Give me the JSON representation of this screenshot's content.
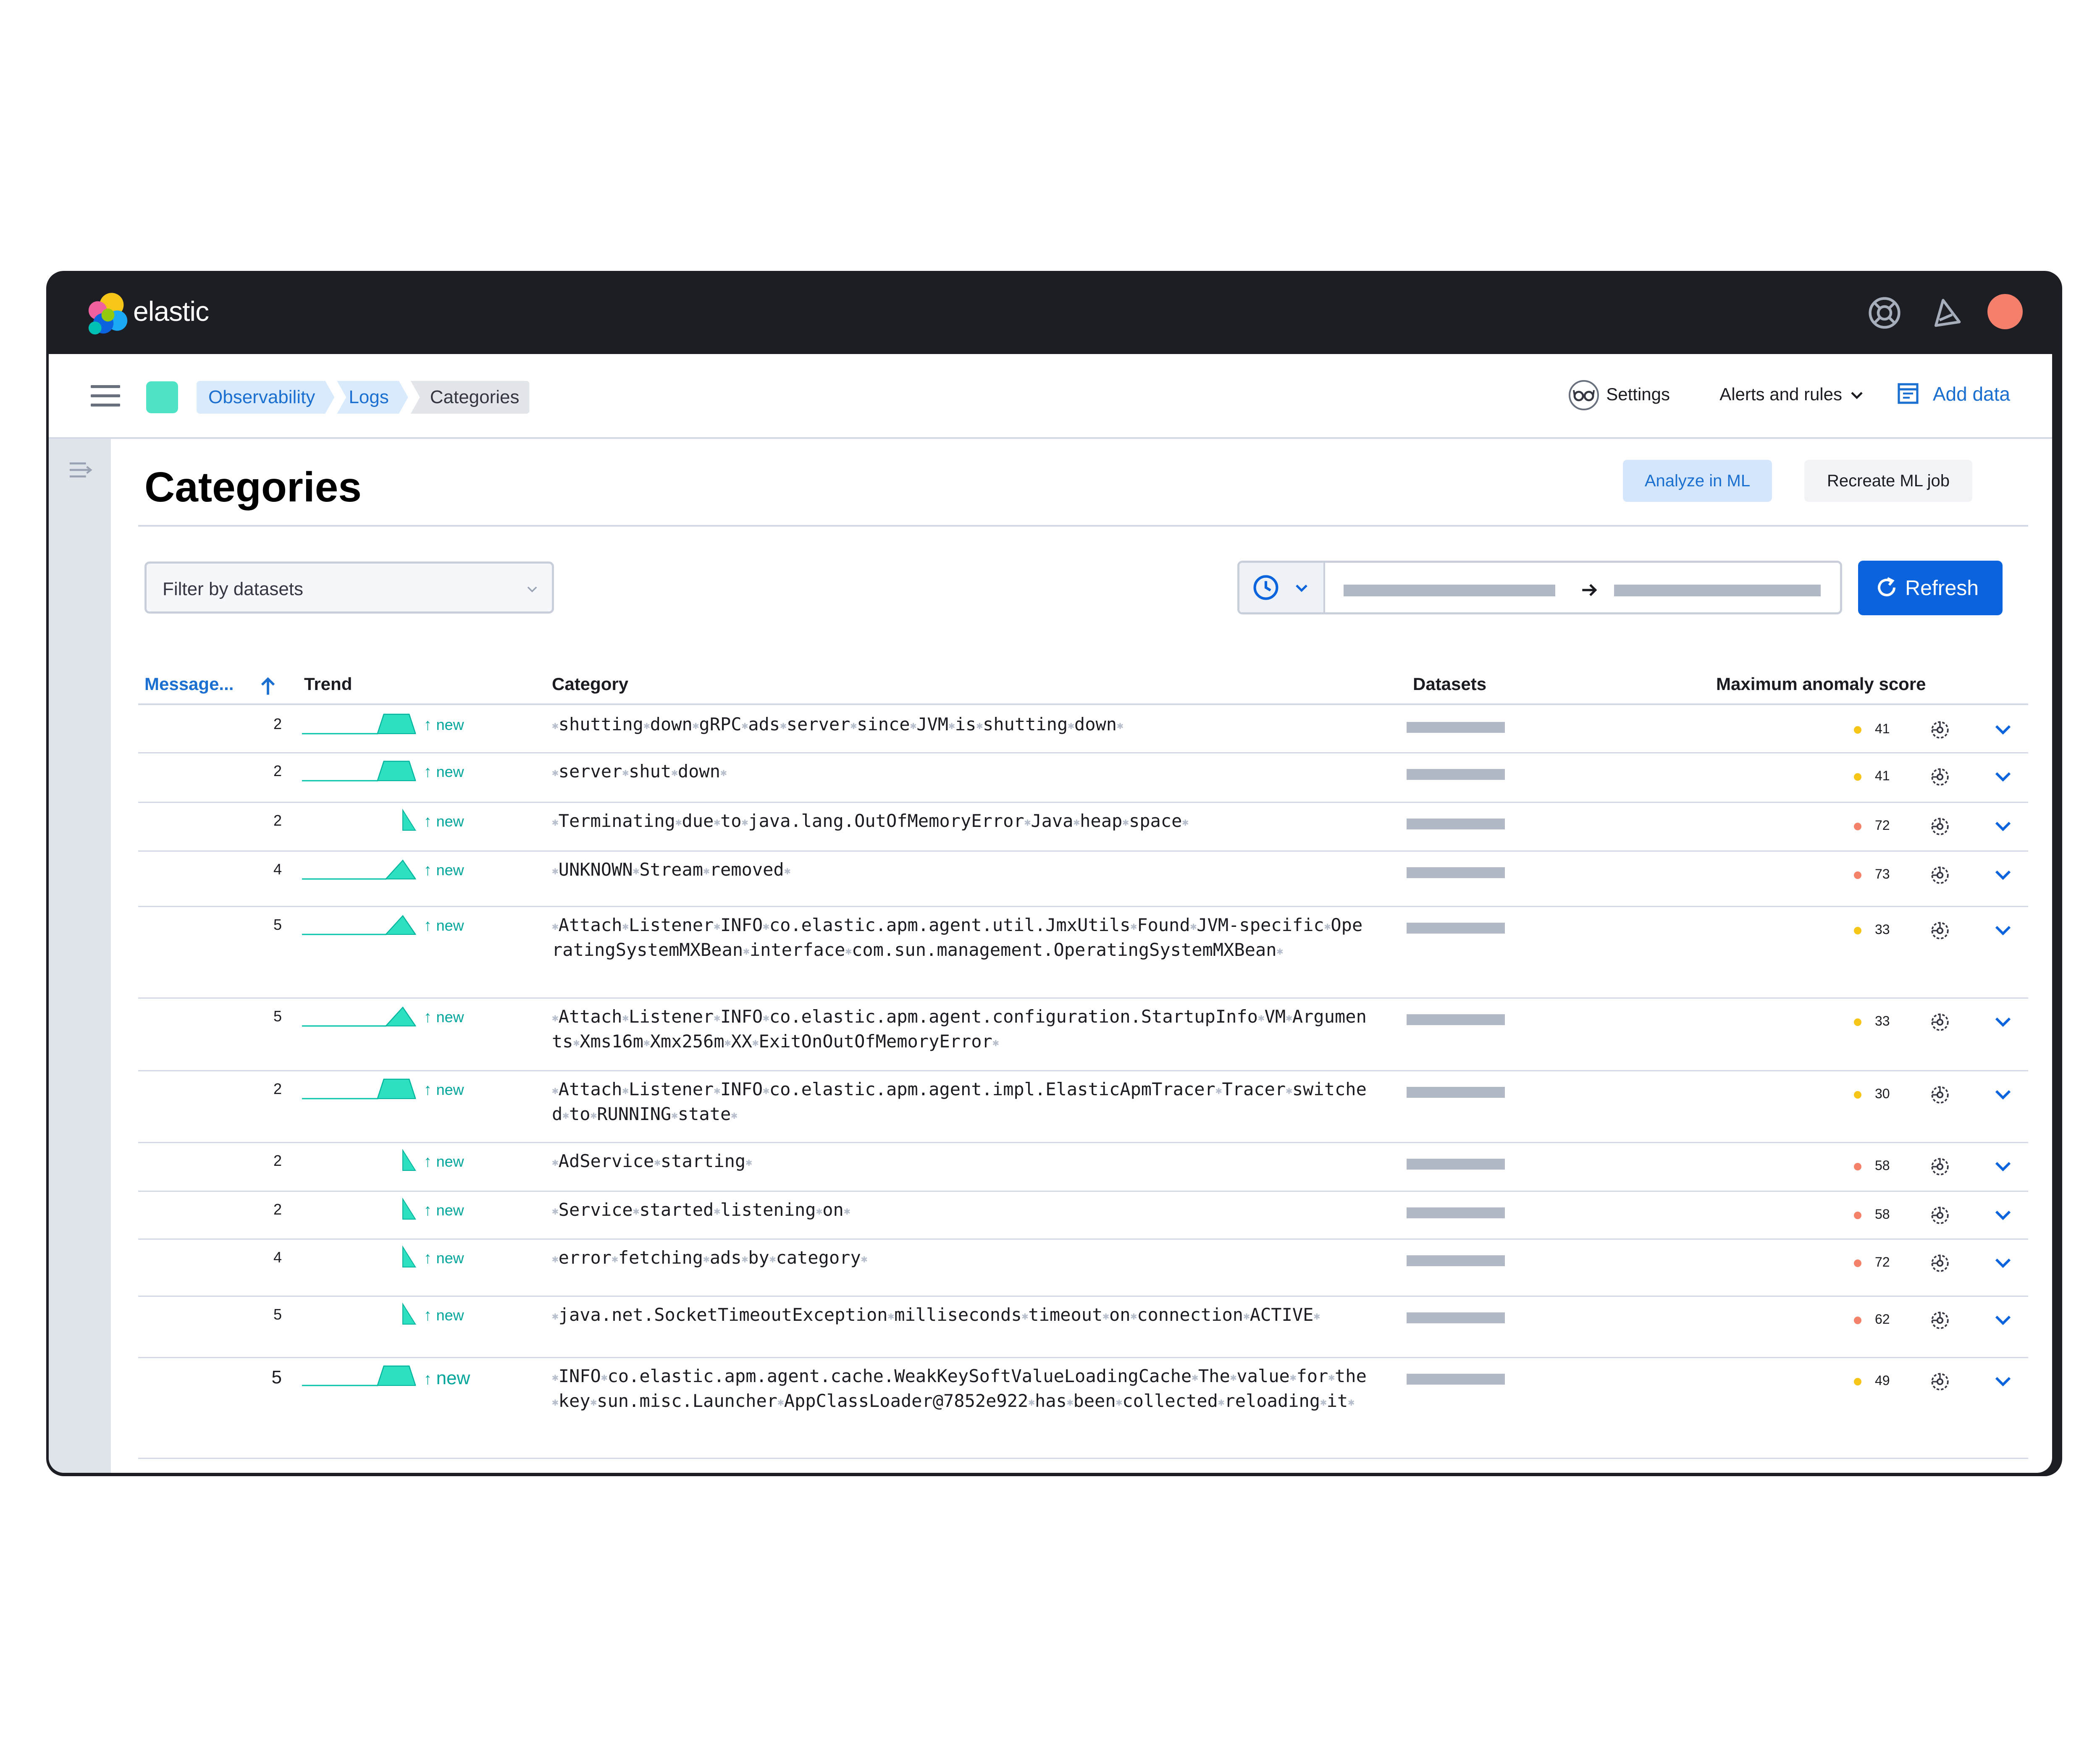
{
  "app": {
    "logo_text": "elastic"
  },
  "header_icons": [
    "help-icon",
    "newsfeed-icon",
    "avatar"
  ],
  "colors": {
    "accent": "#0b64dd",
    "new": "#00a69b",
    "trend": "#2de0c0",
    "yellow": "#f5c518",
    "red": "#f4826b",
    "avatar": "#f47f6b"
  },
  "breadcrumbs": [
    "Observability",
    "Logs",
    "Categories"
  ],
  "top_actions": {
    "settings": "Settings",
    "alerts": "Alerts and rules",
    "add_data": "Add data"
  },
  "page": {
    "title": "Categories",
    "analyze_button": "Analyze in ML",
    "recreate_button": "Recreate ML job",
    "filter_placeholder": "Filter by datasets",
    "refresh_button": "Refresh"
  },
  "table": {
    "columns": [
      "Message...",
      "Trend",
      "Category",
      "Datasets",
      "Maximum anomaly score"
    ],
    "new_label": "new",
    "rows": [
      {
        "count": "2",
        "trend": "plateau",
        "category": [
          "shutting",
          "down",
          "gRPC",
          "ads",
          "server",
          "since",
          "JVM",
          "is",
          "shutting",
          "down"
        ],
        "score": "41",
        "level": "yellow"
      },
      {
        "count": "2",
        "trend": "plateau",
        "category": [
          "server",
          "shut",
          "down"
        ],
        "score": "41",
        "level": "yellow"
      },
      {
        "count": "2",
        "trend": "spike",
        "category": [
          "Terminating",
          "due",
          "to",
          "java.lang.OutOfMemoryError",
          "Java",
          "heap",
          "space"
        ],
        "score": "72",
        "level": "red"
      },
      {
        "count": "4",
        "trend": "peak",
        "category": [
          "UNKNOWN",
          "Stream",
          "removed"
        ],
        "score": "73",
        "level": "red"
      },
      {
        "count": "5",
        "trend": "peak",
        "category": [
          "Attach",
          "Listener",
          "INFO",
          "co.elastic.apm.agent.util.JmxUtils",
          "Found",
          "JVM-specific",
          "OperatingSystemMXBean",
          "interface",
          "com.sun.management.OperatingSystemMXBean"
        ],
        "score": "33",
        "level": "yellow"
      },
      {
        "count": "5",
        "trend": "peak",
        "category": [
          "Attach",
          "Listener",
          "INFO",
          "co.elastic.apm.agent.configuration.StartupInfo",
          "VM",
          "Arguments",
          "Xms16m",
          "Xmx256m",
          "XX",
          "ExitOnOutOfMemoryError"
        ],
        "score": "33",
        "level": "yellow"
      },
      {
        "count": "2",
        "trend": "plateau",
        "category": [
          "Attach",
          "Listener",
          "INFO",
          "co.elastic.apm.agent.impl.ElasticApmTracer",
          "Tracer",
          "switched",
          "to",
          "RUNNING",
          "state"
        ],
        "score": "30",
        "level": "yellow"
      },
      {
        "count": "2",
        "trend": "spike",
        "category": [
          "AdService",
          "starting"
        ],
        "score": "58",
        "level": "red"
      },
      {
        "count": "2",
        "trend": "spike",
        "category": [
          "Service",
          "started",
          "listening",
          "on"
        ],
        "score": "58",
        "level": "red"
      },
      {
        "count": "4",
        "trend": "spike",
        "category": [
          "error",
          "fetching",
          "ads",
          "by",
          "category"
        ],
        "score": "72",
        "level": "red"
      },
      {
        "count": "5",
        "trend": "spike",
        "category": [
          "java.net.SocketTimeoutException",
          "milliseconds",
          "timeout",
          "on",
          "connection",
          "ACTIVE"
        ],
        "score": "62",
        "level": "red"
      },
      {
        "count": "5",
        "trend": "plateau",
        "category": [
          "INFO",
          "co.elastic.apm.agent.cache.WeakKeySoftValueLoadingCache",
          "The",
          "value",
          "for",
          "the",
          "key",
          "sun.misc.Launcher",
          "AppClassLoader@7852e922",
          "has",
          "been",
          "collected",
          "reloading",
          "it"
        ],
        "score": "49",
        "level": "yellow"
      }
    ]
  }
}
